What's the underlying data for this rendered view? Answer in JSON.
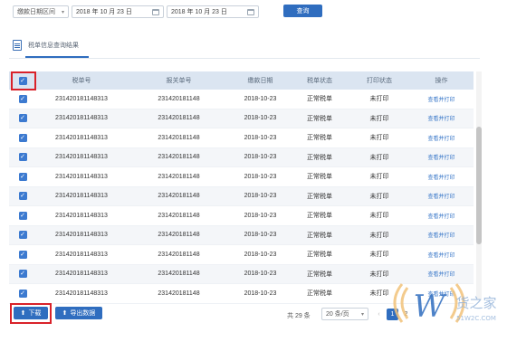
{
  "filter": {
    "range_type": "缴款日期区间",
    "start_date": "2018 年 10 月 23 日",
    "end_date": "2018 年 10 月 23 日",
    "query_label": "查询"
  },
  "section": {
    "title": "税单信息查询结果"
  },
  "table": {
    "headers": [
      "税单号",
      "报关单号",
      "缴款日期",
      "税单状态",
      "打印状态",
      "操作"
    ],
    "rows": [
      {
        "tax_no": "231420181148313",
        "decl_no": "231420181148",
        "date": "2018-10-23",
        "tax_status": "正常税单",
        "print_status": "未打印",
        "action": "查看并打印"
      },
      {
        "tax_no": "231420181148313",
        "decl_no": "231420181148",
        "date": "2018-10-23",
        "tax_status": "正常税单",
        "print_status": "未打印",
        "action": "查看并打印"
      },
      {
        "tax_no": "231420181148313",
        "decl_no": "231420181148",
        "date": "2018-10-23",
        "tax_status": "正常税单",
        "print_status": "未打印",
        "action": "查看并打印"
      },
      {
        "tax_no": "231420181148313",
        "decl_no": "231420181148",
        "date": "2018-10-23",
        "tax_status": "正常税单",
        "print_status": "未打印",
        "action": "查看并打印"
      },
      {
        "tax_no": "231420181148313",
        "decl_no": "231420181148",
        "date": "2018-10-23",
        "tax_status": "正常税单",
        "print_status": "未打印",
        "action": "查看并打印"
      },
      {
        "tax_no": "231420181148313",
        "decl_no": "231420181148",
        "date": "2018-10-23",
        "tax_status": "正常税单",
        "print_status": "未打印",
        "action": "查看并打印"
      },
      {
        "tax_no": "231420181148313",
        "decl_no": "231420181148",
        "date": "2018-10-23",
        "tax_status": "正常税单",
        "print_status": "未打印",
        "action": "查看并打印"
      },
      {
        "tax_no": "231420181148313",
        "decl_no": "231420181148",
        "date": "2018-10-23",
        "tax_status": "正常税单",
        "print_status": "未打印",
        "action": "查看并打印"
      },
      {
        "tax_no": "231420181148313",
        "decl_no": "231420181148",
        "date": "2018-10-23",
        "tax_status": "正常税单",
        "print_status": "未打印",
        "action": "查看并打印"
      },
      {
        "tax_no": "231420181148313",
        "decl_no": "231420181148",
        "date": "2018-10-23",
        "tax_status": "正常税单",
        "print_status": "未打印",
        "action": "查看并打印"
      },
      {
        "tax_no": "231420181148313",
        "decl_no": "231420181148",
        "date": "2018-10-23",
        "tax_status": "正常税单",
        "print_status": "未打印",
        "action": "查看并打印"
      }
    ]
  },
  "footer": {
    "download_label": "下载",
    "export_label": "导出数据",
    "total_text": "共 29 条",
    "page_size": "20 条/页",
    "pages": [
      "1",
      "2"
    ]
  },
  "watermark": {
    "brand": "货之家",
    "url": "51W2C.COM",
    "letter": "W"
  },
  "colors": {
    "primary": "#2f6dbf",
    "highlight": "#d9222a",
    "header_bg": "#dbe5f1"
  }
}
